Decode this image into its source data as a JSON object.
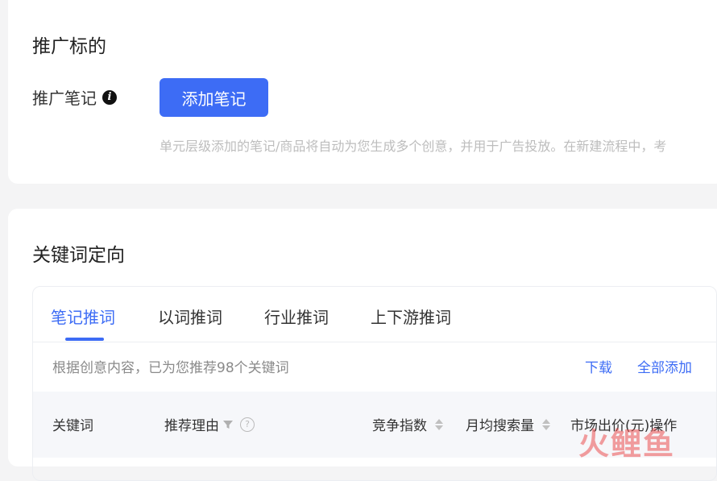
{
  "promo_target": {
    "title": "推广标的",
    "note_label": "推广笔记",
    "info_icon": "info-icon",
    "add_note_button": "添加笔记",
    "hint": "单元层级添加的笔记/商品将自动为您生成多个创意，并用于广告投放。在新建流程中，考"
  },
  "keyword_targeting": {
    "title": "关键词定向",
    "tabs": [
      "笔记推词",
      "以词推词",
      "行业推词",
      "上下游推词"
    ],
    "active_tab": "笔记推词",
    "recommend_text": "根据创意内容，已为您推荐98个关键词",
    "download_link": "下载",
    "add_all_link": "全部添加",
    "table_headers": {
      "keyword": "关键词",
      "reason": "推荐理由",
      "competition": "竞争指数",
      "monthly_search": "月均搜索量",
      "market_bid": "市场出价(元)",
      "action": "操作"
    }
  },
  "watermark": "火鲤鱼",
  "colors": {
    "accent": "#3d6cf5",
    "watermark": "#eb5050"
  }
}
